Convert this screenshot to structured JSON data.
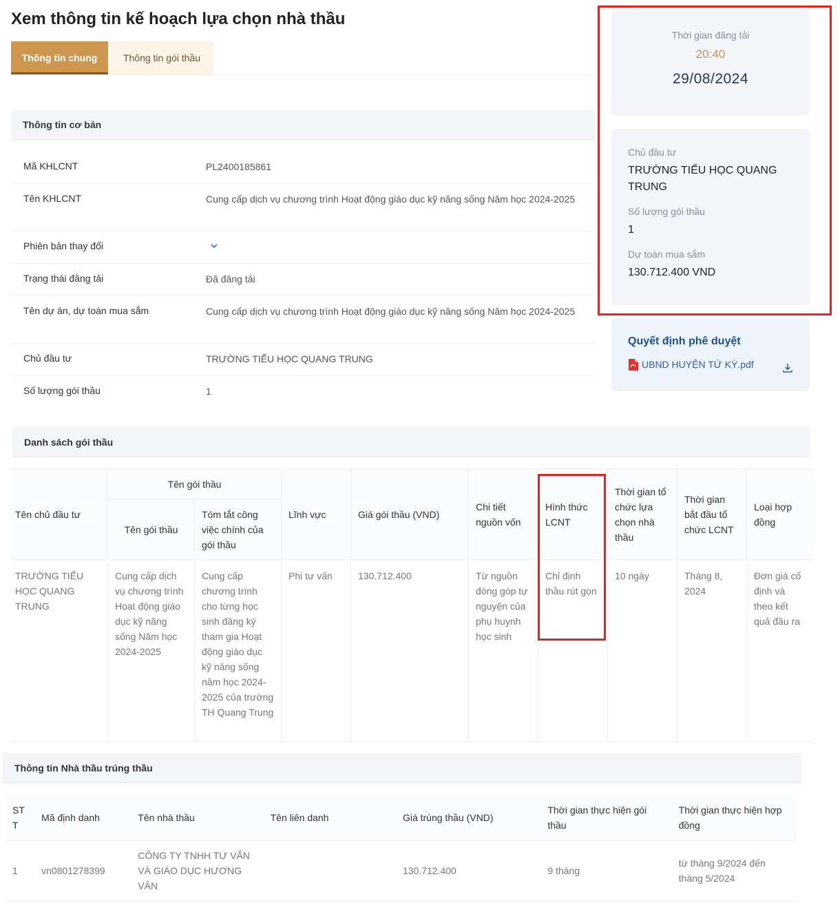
{
  "page": {
    "title": "Xem thông tin kế hoạch lựa chọn nhà thầu"
  },
  "tabs": [
    {
      "label": "Thông tin chung",
      "active": true
    },
    {
      "label": "Thông tin gói thầu",
      "active": false
    }
  ],
  "basic_info": {
    "header": "Thông tin cơ bản",
    "rows": [
      {
        "label": "Mã KHLCNT",
        "value": "PL2400185861"
      },
      {
        "label": "Tên KHLCNT",
        "value": "Cung cấp dịch vụ chương trình Hoạt động giáo dục kỹ năng sống Năm học 2024-2025"
      },
      {
        "label": "Phiên bản thay đổi",
        "value": ""
      },
      {
        "label": "Trạng thái đăng tải",
        "value": "Đã đăng tải"
      },
      {
        "label": "Tên dự án, dự toán mua sắm",
        "value": "Cung cấp dịch vụ chương trình Hoạt động giáo dục kỹ năng sống Năm học 2024-2025"
      },
      {
        "label": "Chủ đầu tư",
        "value": "TRƯỜNG TIỂU HỌC QUANG TRUNG"
      },
      {
        "label": "Số lượng gói thầu",
        "value": "1"
      }
    ]
  },
  "side": {
    "post_label": "Thời gian đăng tải",
    "post_time": "20:40",
    "post_date": "29/08/2024",
    "investor_label": "Chủ đầu tư",
    "investor_value": "TRƯỜNG TIỂU HỌC QUANG TRUNG",
    "count_label": "Số lượng gói thầu",
    "count_value": "1",
    "budget_label": "Dự toán mua sắm",
    "budget_value": "130.712.400 VND",
    "decision_title": "Quyết định phê duyệt",
    "decision_file": "UBND HUYỆN TỨ KỲ.pdf"
  },
  "packages": {
    "header": "Danh sách gói thầu",
    "columns": {
      "investor": "Tên chủ đầu tư",
      "package_group": "Tên gói thầu",
      "package_name": "Tên gói thầu",
      "package_summary": "Tóm tắt công việc chính của gói thầu",
      "field": "Lĩnh vực",
      "price": "Giá gói thầu (VND)",
      "funding": "Chi tiết nguồn vốn",
      "method": "Hình thức LCNT",
      "selection_time": "Thời gian tổ chức lựa chọn nhà thầu",
      "start_time": "Thời gian bắt đầu tổ chức LCNT",
      "contract_type": "Loại hợp đồng"
    },
    "row": {
      "investor": "TRƯỜNG TIỂU HỌC QUANG TRUNG",
      "package_name": "Cung cấp dịch vụ chương trình Hoạt động giáo dục kỹ năng sống Năm học 2024-2025",
      "package_summary": "Cung cấp chương trình cho từng học sinh đăng ký tham gia Hoạt động giáo dục kỹ năng sống năm học 2024-2025 của trường TH Quang Trung",
      "field": "Phi tư vấn",
      "price": "130.712.400",
      "funding": "Từ nguồn đóng góp tự nguyện của phụ huynh học sinh",
      "method": "Chỉ định thầu rút gọn",
      "selection_time": "10 ngày",
      "start_time": "Tháng 8, 2024",
      "contract_type": "Đơn giá cố định và theo kết quả đầu ra"
    }
  },
  "winners": {
    "header": "Thông tin Nhà thầu trúng thầu",
    "columns": {
      "stt": "STT",
      "id": "Mã định danh",
      "name": "Tên nhà thầu",
      "joint": "Tên liên danh",
      "price": "Giá trúng thầu (VND)",
      "package_duration": "Thời gian thực hiện gói thầu",
      "contract_duration": "Thời gian thực hiện hợp đồng"
    },
    "row": {
      "stt": "1",
      "id": "vn0801278399",
      "name": "CÔNG TY TNHH TƯ VẤN VÀ GIÁO DỤC HƯƠNG VÂN",
      "joint": "",
      "price": "130.712.400",
      "package_duration": "9 tháng",
      "contract_duration": "từ tháng 9/2024 đến tháng 5/2024"
    }
  },
  "colors": {
    "accent": "#cf974e",
    "highlight": "#e02424",
    "link": "#2a5fb0"
  },
  "icons": [
    "chevron-down-icon",
    "pdf-icon",
    "download-icon"
  ]
}
